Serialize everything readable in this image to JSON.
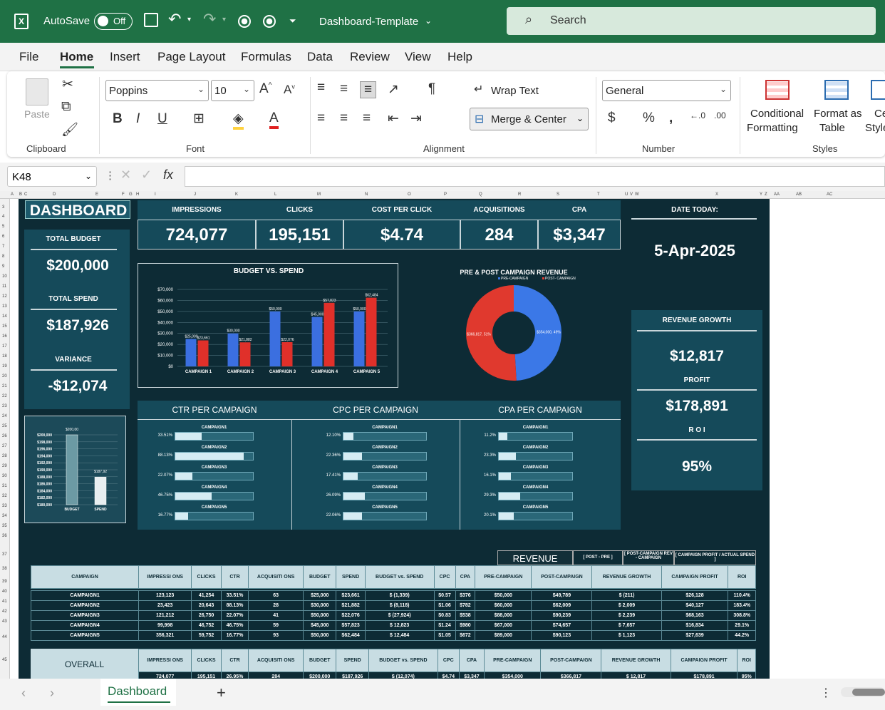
{
  "app": {
    "autosave": "AutoSave",
    "toggle": "Off",
    "filename": "Dashboard-Template",
    "search_placeholder": "Search"
  },
  "tabs": [
    "File",
    "Home",
    "Insert",
    "Page Layout",
    "Formulas",
    "Data",
    "Review",
    "View",
    "Help"
  ],
  "ribbon": {
    "paste": "Paste",
    "clipboard": "Clipboard",
    "font_name": "Poppins",
    "font_size": "10",
    "font": "Font",
    "wrap": "Wrap Text",
    "merge": "Merge & Center",
    "alignment": "Alignment",
    "number_format": "General",
    "number": "Number",
    "cond1": "Conditional",
    "cond2": "Formatting",
    "fmt1": "Format as",
    "fmt2": "Table",
    "cell1": "Ce",
    "cell2": "Style",
    "styles": "Styles"
  },
  "formula": {
    "cell_ref": "K48",
    "fx": "fx"
  },
  "columns": [
    "A",
    "B",
    "C",
    "D",
    "E",
    "F",
    "G",
    "H",
    "I",
    "J",
    "K",
    "L",
    "M",
    "N",
    "O",
    "P",
    "Q",
    "R",
    "S",
    "T",
    "U",
    "V",
    "W",
    "X",
    "Y",
    "Z",
    "AA",
    "AB",
    "AC"
  ],
  "rows": [
    "3",
    "4",
    "5",
    "6",
    "7",
    "8",
    "9",
    "10",
    "11",
    "12",
    "13",
    "14",
    "15",
    "16",
    "17",
    "18",
    "19",
    "20",
    "21",
    "22",
    "23",
    "24",
    "25",
    "26",
    "27",
    "28",
    "29",
    "30",
    "31",
    "32",
    "33",
    "34",
    "35",
    "36",
    "37",
    "38",
    "39",
    "40",
    "41",
    "42",
    "43",
    "44",
    "45"
  ],
  "dashboard": {
    "title": "DASHBOARD",
    "kpis": [
      {
        "label": "IMPRESSIONS",
        "value": "724,077"
      },
      {
        "label": "CLICKS",
        "value": "195,151"
      },
      {
        "label": "COST PER CLICK",
        "value": "$4.74"
      },
      {
        "label": "ACQUISITIONS",
        "value": "284"
      },
      {
        "label": "CPA",
        "value": "$3,347"
      }
    ],
    "date_label": "DATE TODAY:",
    "date": "5-Apr-2025",
    "total_budget_label": "TOTAL BUDGET",
    "total_budget": "$200,000",
    "total_spend_label": "TOTAL SPEND",
    "total_spend": "$187,926",
    "variance_label": "VARIANCE",
    "variance": "-$12,074",
    "revenue_growth_label": "REVENUE GROWTH",
    "revenue_growth": "$12,817",
    "profit_label": "PROFIT",
    "profit": "$178,891",
    "roi_label": "R O I",
    "roi": "95%",
    "ctr_title": "CTR PER CAMPAIGN",
    "cpc_title": "CPC PER CAMPAIGN",
    "cpa_title": "CPA PER CAMPAIGN",
    "revenue_hdr": "REVENUE",
    "post_pre": "[ POST - PRE ]",
    "post_rev": "[ POST-CAMPAIGN REV - CAMPAIGN",
    "profit_spend": "[ CAMPAIGN PROFIT / ACTUAL SPEND ]",
    "overall": "OVERALL"
  },
  "chart_data": [
    {
      "type": "bar",
      "title": "BUDGET VS. SPEND",
      "categories": [
        "CAMPAIGN 1",
        "CAMPAIGN 2",
        "CAMPAIGN 3",
        "CAMPAIGN 4",
        "CAMPAIGN 5"
      ],
      "series": [
        {
          "values": [
            25000,
            30000,
            50000,
            45000,
            50000
          ],
          "labels": [
            "$25,000",
            "$30,000",
            "$50,000",
            "$45,000",
            "$50,000"
          ],
          "color": "#3b6fe0"
        },
        {
          "values": [
            23661,
            21882,
            22076,
            57823,
            62484
          ],
          "labels": [
            "$23,661",
            "$21,882",
            "$22,076",
            "$57,823",
            "$62,484"
          ],
          "color": "#e0302a"
        }
      ],
      "yticks": [
        "$70,000",
        "$60,000",
        "$50,000",
        "$40,000",
        "$30,000",
        "$20,000",
        "$10,000",
        "$0"
      ],
      "ylim": [
        0,
        70000
      ]
    },
    {
      "type": "pie",
      "title": "PRE & POST CAMPAIGN REVENUE",
      "series": [
        {
          "name": "PRE-CAMPAIGN",
          "value": 354000,
          "label": "$354,000, 49%",
          "color": "#3b78e7"
        },
        {
          "name": "POST- CAMPAIGN",
          "value": 366817,
          "label": "$366,817, 51%",
          "color": "#e0392e"
        }
      ]
    },
    {
      "type": "bar",
      "categories": [
        "BUDGET",
        "SPEND"
      ],
      "values": [
        200000,
        187926
      ],
      "labels": [
        "$200,00",
        "$187,92"
      ],
      "yticks": [
        "$200,000",
        "$198,000",
        "$196,000",
        "$194,000",
        "$192,000",
        "$190,000",
        "$188,000",
        "$186,000",
        "$184,000",
        "$182,000",
        "$180,000"
      ],
      "ylim": [
        180000,
        200000
      ]
    },
    {
      "type": "bar",
      "title": "CTR PER CAMPAIGN",
      "categories": [
        "CAMPAIGN1",
        "CAMPAIGN2",
        "CAMPAIGN3",
        "CAMPAIGN4",
        "CAMPAIGN5"
      ],
      "values": [
        33.51,
        88.13,
        22.07,
        46.75,
        16.77
      ],
      "labels": [
        "33.51%",
        "88.13%",
        "22.07%",
        "46.75%",
        "16.77%"
      ]
    },
    {
      "type": "bar",
      "title": "CPC PER CAMPAIGN",
      "categories": [
        "CAMPAIGN1",
        "CAMPAIGN2",
        "CAMPAIGN3",
        "CAMPAIGN4",
        "CAMPAIGN5"
      ],
      "values": [
        12.1,
        22.36,
        17.41,
        26.09,
        22.06
      ],
      "labels": [
        "12.10%",
        "22.36%",
        "17.41%",
        "26.09%",
        "22.06%"
      ]
    },
    {
      "type": "bar",
      "title": "CPA PER CAMPAIGN",
      "categories": [
        "CAMPAIGN1",
        "CAMPAIGN2",
        "CAMPAIGN3",
        "CAMPAIGN4",
        "CAMPAIGN5"
      ],
      "values": [
        11.2,
        23.3,
        16.1,
        29.3,
        20.1
      ],
      "labels": [
        "11.2%",
        "23.3%",
        "16.1%",
        "29.3%",
        "20.1%"
      ]
    },
    {
      "type": "table",
      "columns": [
        "CAMPAIGN",
        "IMPRESSI ONS",
        "CLICKS",
        "CTR",
        "ACQUISITI ONS",
        "BUDGET",
        "SPEND",
        "BUDGET vs. SPEND",
        "CPC",
        "CPA",
        "PRE-CAMPAIGN",
        "POST-CAMPAIGN",
        "REVENUE GROWTH",
        "CAMPAIGN PROFIT",
        "ROI"
      ],
      "rows": [
        [
          "CAMPAIGN1",
          "123,123",
          "41,254",
          "33.51%",
          "63",
          "$25,000",
          "$23,661",
          "$ (1,339)",
          "$0.57",
          "$376",
          "$50,000",
          "$49,789",
          "$ (211)",
          "$26,128",
          "110.4%"
        ],
        [
          "CAMPAIGN2",
          "23,423",
          "20,643",
          "88.13%",
          "28",
          "$30,000",
          "$21,882",
          "$ (8,118)",
          "$1.06",
          "$782",
          "$60,000",
          "$62,009",
          "$ 2,009",
          "$40,127",
          "183.4%"
        ],
        [
          "CAMPAIGN3",
          "121,212",
          "26,750",
          "22.07%",
          "41",
          "$50,000",
          "$22,076",
          "$ (27,924)",
          "$0.83",
          "$538",
          "$88,000",
          "$90,239",
          "$ 2,239",
          "$68,163",
          "308.8%"
        ],
        [
          "CAMPAIGN4",
          "99,998",
          "46,752",
          "46.75%",
          "59",
          "$45,000",
          "$57,823",
          "$ 12,823",
          "$1.24",
          "$980",
          "$67,000",
          "$74,657",
          "$ 7,657",
          "$16,834",
          "29.1%"
        ],
        [
          "CAMPAIGN5",
          "356,321",
          "59,752",
          "16.77%",
          "93",
          "$50,000",
          "$62,484",
          "$ 12,484",
          "$1.05",
          "$672",
          "$89,000",
          "$90,123",
          "$ 1,123",
          "$27,639",
          "44.2%"
        ]
      ],
      "overall_row": [
        "",
        "724,077",
        "195,151",
        "26.95%",
        "284",
        "$200,000",
        "$187,926",
        "$ (12,074)",
        "$4.74",
        "$3,347",
        "$354,000",
        "$366,817",
        "$ 12,817",
        "$178,891",
        "95%"
      ]
    }
  ],
  "sheet": {
    "tab": "Dashboard",
    "add": "+"
  }
}
